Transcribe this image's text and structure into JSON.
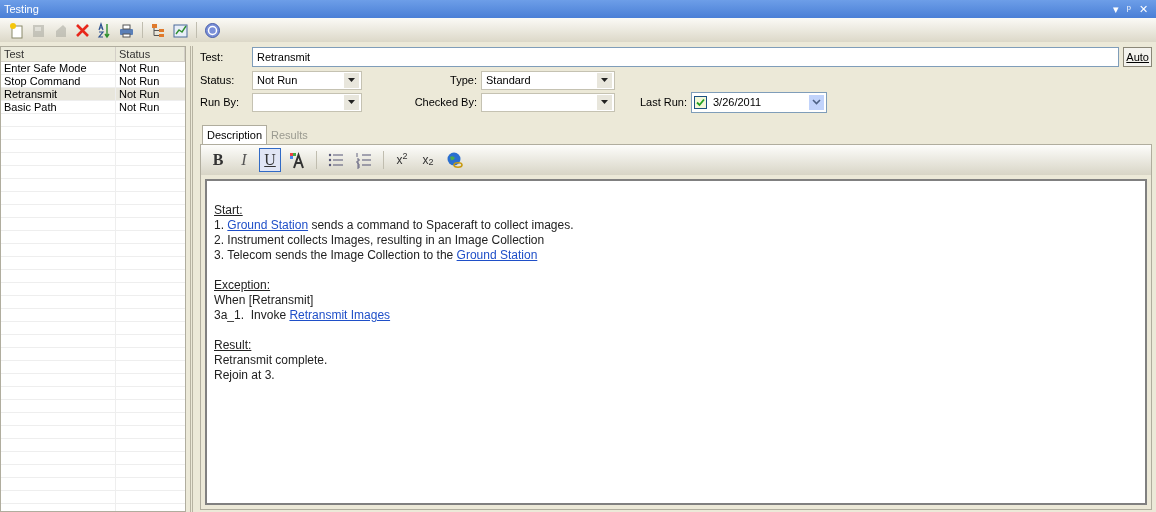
{
  "window": {
    "title": "Testing",
    "controls": [
      "▾",
      "ᵖ",
      "✕"
    ]
  },
  "toolbar": [
    {
      "kind": "new",
      "disabled": false
    },
    {
      "kind": "save",
      "disabled": true
    },
    {
      "kind": "copy",
      "disabled": true
    },
    {
      "kind": "delete",
      "disabled": false
    },
    {
      "kind": "sort",
      "disabled": false
    },
    {
      "kind": "print",
      "disabled": false
    },
    {
      "kind": "tree",
      "disabled": false
    },
    {
      "kind": "report",
      "disabled": false
    },
    {
      "kind": "help",
      "disabled": false
    }
  ],
  "test_list": {
    "columns": [
      "Test",
      "Status"
    ],
    "rows": [
      {
        "test": "Enter Safe Mode",
        "status": "Not Run",
        "selected": false
      },
      {
        "test": "Stop Command",
        "status": "Not Run",
        "selected": false
      },
      {
        "test": "Retransmit",
        "status": "Not Run",
        "selected": true
      },
      {
        "test": "Basic Path",
        "status": "Not Run",
        "selected": false
      }
    ]
  },
  "form": {
    "test_label": "Test:",
    "test_value": "Retransmit",
    "auto_button": "Auto",
    "status_label": "Status:",
    "status_value": "Not Run",
    "type_label": "Type:",
    "type_value": "Standard",
    "run_by_label": "Run By:",
    "checked_by_label": "Checked By:",
    "last_run_label": "Last Run:",
    "last_run_checked": true,
    "last_run_value": "3/26/2011"
  },
  "tabs": [
    {
      "label": "Description",
      "selected": true
    },
    {
      "label": "Results",
      "selected": false
    }
  ],
  "format_buttons": [
    {
      "kind": "bold",
      "label": "B",
      "selected": false
    },
    {
      "kind": "italic",
      "label": "I",
      "selected": false
    },
    {
      "kind": "underline",
      "label": "U",
      "selected": true
    },
    {
      "kind": "font-color",
      "selected": false
    },
    {
      "kind": "separator"
    },
    {
      "kind": "bullets",
      "selected": false
    },
    {
      "kind": "numbering",
      "selected": false
    },
    {
      "kind": "separator"
    },
    {
      "kind": "superscript",
      "label": "x$^{2}$",
      "selected": false
    },
    {
      "kind": "subscript",
      "label": "x$_{2}$",
      "selected": false
    },
    {
      "kind": "link",
      "selected": false
    }
  ],
  "description": [
    {
      "kind": "heading",
      "segments": [
        {
          "kind": "text",
          "text": "Start:"
        }
      ]
    },
    {
      "kind": "line",
      "segments": [
        {
          "kind": "text",
          "text": "1. "
        },
        {
          "kind": "link",
          "text": "Ground Station"
        },
        {
          "kind": "text",
          "text": " sends a command to Spaceraft to collect images."
        }
      ]
    },
    {
      "kind": "line",
      "segments": [
        {
          "kind": "text",
          "text": "2. Instrument collects Images, resulting in an Image Collection"
        }
      ]
    },
    {
      "kind": "line",
      "segments": [
        {
          "kind": "text",
          "text": "3. Telecom sends the Image Collection to the "
        },
        {
          "kind": "link",
          "text": "Ground Station"
        }
      ]
    },
    {
      "kind": "blank"
    },
    {
      "kind": "heading",
      "segments": [
        {
          "kind": "text",
          "text": "Exception:"
        }
      ]
    },
    {
      "kind": "line",
      "segments": [
        {
          "kind": "text",
          "text": "When [Retransmit]"
        }
      ]
    },
    {
      "kind": "line",
      "segments": [
        {
          "kind": "text",
          "text": "3a_1.  Invoke "
        },
        {
          "kind": "link",
          "text": "Retransmit Images"
        }
      ]
    },
    {
      "kind": "blank"
    },
    {
      "kind": "heading",
      "segments": [
        {
          "kind": "text",
          "text": "Result:"
        }
      ]
    },
    {
      "kind": "line",
      "segments": [
        {
          "kind": "text",
          "text": "Retransmit complete."
        }
      ]
    },
    {
      "kind": "line",
      "segments": [
        {
          "kind": "text",
          "text": "Rejoin at 3."
        }
      ]
    }
  ]
}
